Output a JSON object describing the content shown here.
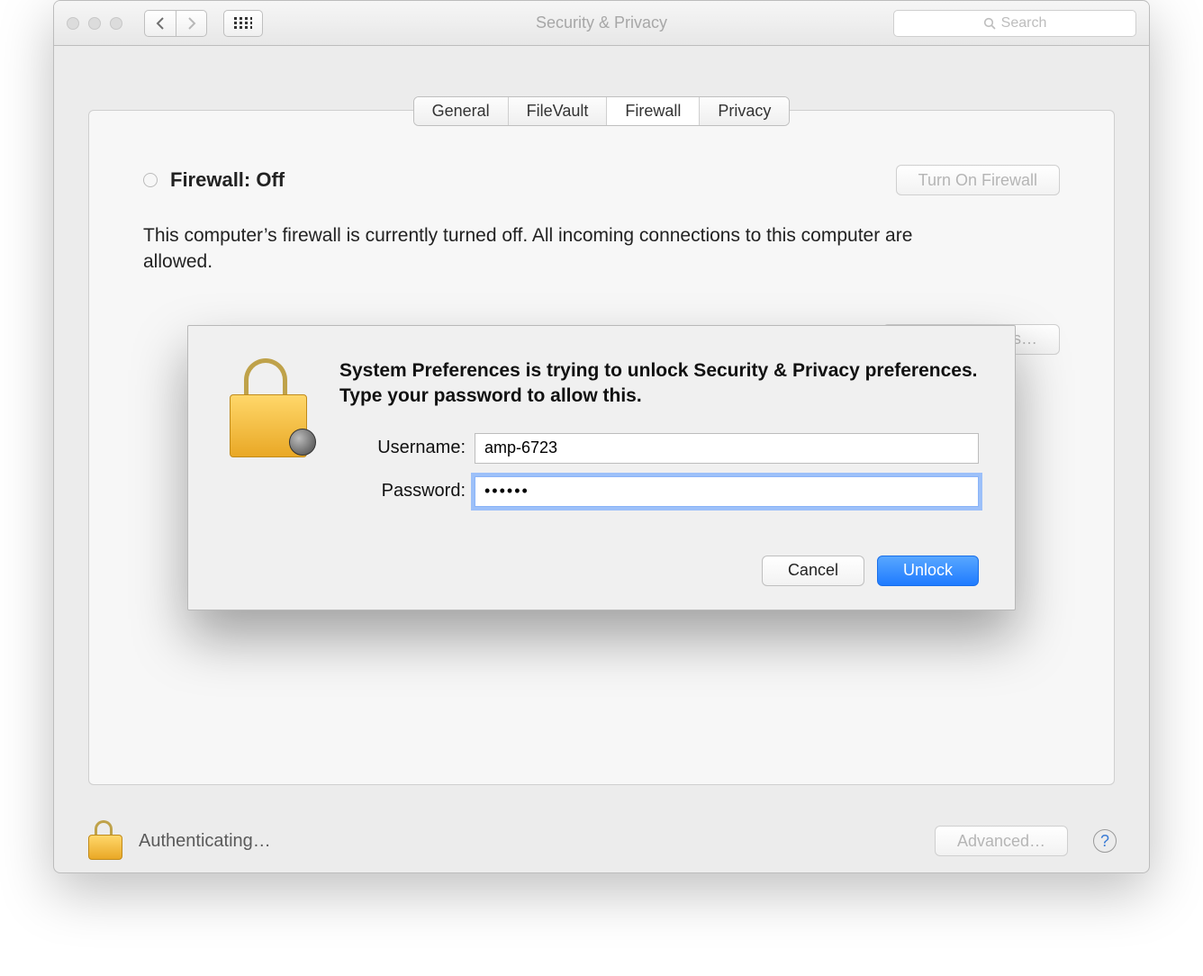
{
  "window": {
    "title": "Security & Privacy",
    "search_placeholder": "Search"
  },
  "tabs": {
    "general": "General",
    "filevault": "FileVault",
    "firewall": "Firewall",
    "privacy": "Privacy",
    "active": "firewall"
  },
  "firewall": {
    "status_title": "Firewall: Off",
    "turn_on_label": "Turn On Firewall",
    "description": "This computer’s firewall is currently turned off. All incoming connections to this computer are allowed.",
    "options_label": "Firewall Options…"
  },
  "footer": {
    "auth_status": "Authenticating…",
    "advanced_label": "Advanced…",
    "help_label": "?"
  },
  "auth": {
    "message": "System Preferences is trying to unlock Security & Privacy preferences. Type your password to allow this.",
    "username_label": "Username:",
    "password_label": "Password:",
    "username_value": "amp-6723",
    "password_value": "••••••",
    "cancel_label": "Cancel",
    "unlock_label": "Unlock"
  }
}
